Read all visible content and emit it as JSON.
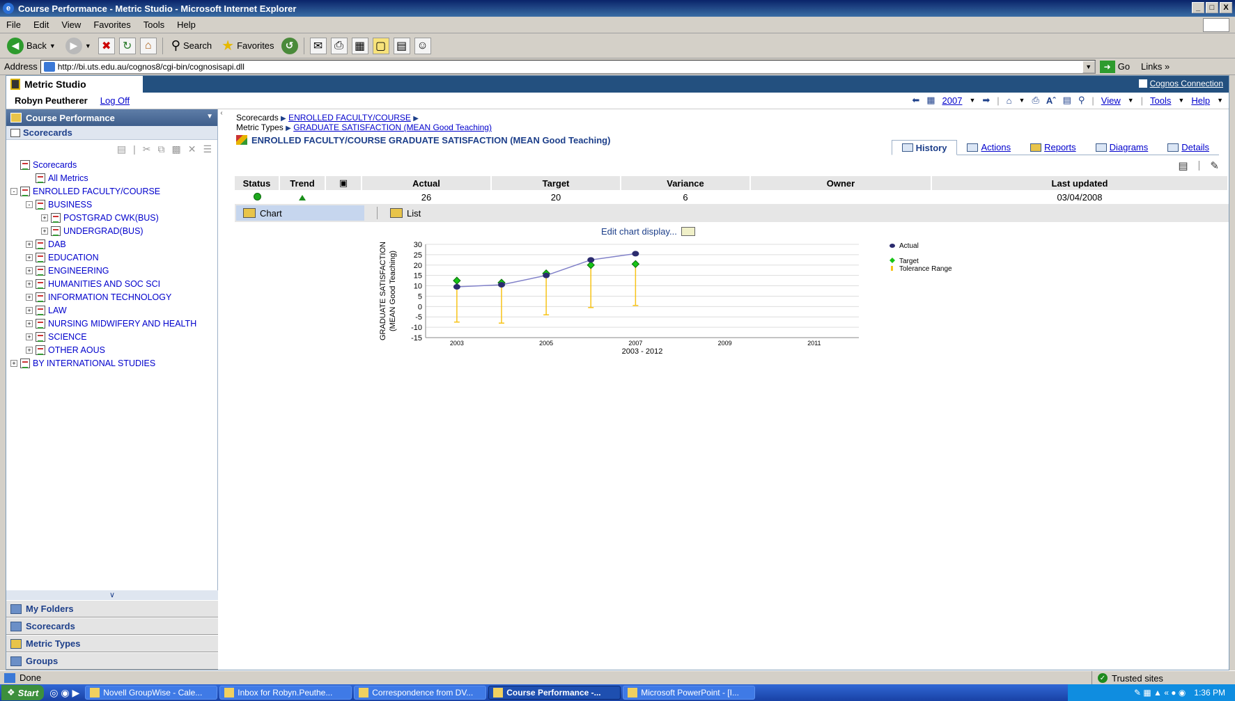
{
  "window": {
    "title": "Course Performance - Metric Studio - Microsoft Internet Explorer",
    "controls": [
      "_",
      "□",
      "X"
    ]
  },
  "menu": [
    "File",
    "Edit",
    "View",
    "Favorites",
    "Tools",
    "Help"
  ],
  "toolbar": {
    "back": "Back",
    "search": "Search",
    "favorites": "Favorites"
  },
  "address": {
    "label": "Address",
    "url": "http://bi.uts.edu.au/cognos8/cgi-bin/cognosisapi.dll",
    "go": "Go",
    "links": "Links"
  },
  "app": {
    "brand": "Metric Studio",
    "cognos_connection": "Cognos Connection",
    "user": "Robyn Peutherer",
    "logoff": "Log Off",
    "year": "2007",
    "view_menu": "View",
    "tools_menu": "Tools",
    "help_menu": "Help"
  },
  "left": {
    "header": "Course Performance",
    "scorecards_header": "Scorecards",
    "tree": [
      {
        "label": "Scorecards",
        "indent": 0,
        "toggle": "",
        "icon": "scorecards-folder"
      },
      {
        "label": "All Metrics",
        "indent": 1,
        "toggle": "",
        "icon": "list"
      },
      {
        "label": "ENROLLED FACULTY/COURSE",
        "indent": 0,
        "toggle": "-",
        "icon": "scorecard"
      },
      {
        "label": "BUSINESS",
        "indent": 1,
        "toggle": "-",
        "icon": "scorecard"
      },
      {
        "label": "POSTGRAD CWK(BUS)",
        "indent": 2,
        "toggle": "+",
        "icon": "scorecard"
      },
      {
        "label": "UNDERGRAD(BUS)",
        "indent": 2,
        "toggle": "+",
        "icon": "scorecard"
      },
      {
        "label": "DAB",
        "indent": 1,
        "toggle": "+",
        "icon": "scorecard"
      },
      {
        "label": "EDUCATION",
        "indent": 1,
        "toggle": "+",
        "icon": "scorecard"
      },
      {
        "label": "ENGINEERING",
        "indent": 1,
        "toggle": "+",
        "icon": "scorecard"
      },
      {
        "label": "HUMANITIES AND SOC SCI",
        "indent": 1,
        "toggle": "+",
        "icon": "scorecard"
      },
      {
        "label": "INFORMATION TECHNOLOGY",
        "indent": 1,
        "toggle": "+",
        "icon": "scorecard"
      },
      {
        "label": "LAW",
        "indent": 1,
        "toggle": "+",
        "icon": "scorecard"
      },
      {
        "label": "NURSING MIDWIFERY AND HEALTH",
        "indent": 1,
        "toggle": "+",
        "icon": "scorecard"
      },
      {
        "label": "SCIENCE",
        "indent": 1,
        "toggle": "+",
        "icon": "scorecard"
      },
      {
        "label": "OTHER AOUS",
        "indent": 1,
        "toggle": "+",
        "icon": "scorecard"
      },
      {
        "label": "BY INTERNATIONAL STUDIES",
        "indent": 0,
        "toggle": "+",
        "icon": "scorecard"
      }
    ],
    "accordion": [
      "My Folders",
      "Scorecards",
      "Metric Types",
      "Groups"
    ]
  },
  "right": {
    "crumb_scorecards": "Scorecards",
    "crumb_scorecard": "ENROLLED FACULTY/COURSE",
    "crumb_metric_types": "Metric Types",
    "crumb_metric_type": "GRADUATE SATISFACTION (MEAN Good Teaching)",
    "metric_title": "ENROLLED FACULTY/COURSE GRADUATE SATISFACTION (MEAN Good Teaching)",
    "tabs": [
      "History",
      "Actions",
      "Reports",
      "Diagrams",
      "Details"
    ],
    "summary_headers": [
      "Status",
      "Trend",
      "",
      "Actual",
      "Target",
      "Variance",
      "Owner",
      "Last updated"
    ],
    "summary_values": {
      "actual": "26",
      "target": "20",
      "variance": "6",
      "owner": "",
      "last_updated": "03/04/2008"
    },
    "status_color": "#1ea81e",
    "trend": "up",
    "view_chart": "Chart",
    "view_list": "List",
    "edit_chart": "Edit chart display..."
  },
  "chart_data": {
    "type": "line",
    "ylabel_line1": "GRADUATE SATISFACTION",
    "ylabel_line2": "(MEAN Good Teaching)",
    "range_label": "2003 - 2012",
    "x_ticks": [
      "2003",
      "2005",
      "2007",
      "2009",
      "2011"
    ],
    "y_ticks": [
      30,
      25,
      20,
      15,
      10,
      5,
      0,
      -5,
      -10,
      -15
    ],
    "ylim": [
      -15,
      30
    ],
    "x": [
      2003,
      2004,
      2005,
      2006,
      2007
    ],
    "series": [
      {
        "name": "Actual",
        "values": [
          9.5,
          10.5,
          15,
          22.5,
          25.5
        ],
        "color": "#2b2b6e"
      },
      {
        "name": "Target",
        "values": [
          12.5,
          11.5,
          16,
          20,
          20.5
        ],
        "color": "#17c417"
      }
    ],
    "tolerance": {
      "name": "Tolerance Range",
      "low": [
        -7.5,
        -8,
        -4,
        -0.5,
        0.5
      ],
      "high": [
        12.5,
        11.5,
        16,
        20,
        20.5
      ],
      "color": "#f7c317"
    },
    "legend_position": "top-right"
  },
  "status": {
    "left": "Done",
    "zone": "Trusted sites"
  },
  "taskbar": {
    "start": "Start",
    "items": [
      "Novell GroupWise - Cale...",
      "Inbox for Robyn.Peuthe...",
      "Correspondence from DV...",
      "Course Performance -...",
      "Microsoft PowerPoint - [I..."
    ],
    "active": 3,
    "clock": "1:36 PM"
  }
}
